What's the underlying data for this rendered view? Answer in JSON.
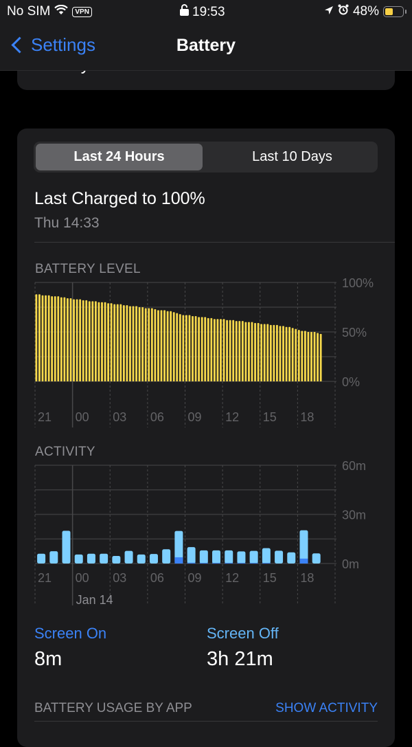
{
  "status_bar": {
    "carrier": "No SIM",
    "vpn": "VPN",
    "time": "19:53",
    "battery_percent": "48%",
    "battery_level": 0.48,
    "battery_color": "#f7d046"
  },
  "nav": {
    "back_label": "Settings",
    "title": "Battery"
  },
  "health_row": {
    "label": "Battery Health"
  },
  "segmented": {
    "options": [
      "Last 24 Hours",
      "Last 10 Days"
    ],
    "selected": "Last 24 Hours"
  },
  "last_charged": {
    "title": "Last Charged to 100%",
    "time": "Thu 14:33"
  },
  "battery_section_label": "BATTERY LEVEL",
  "activity_section_label": "ACTIVITY",
  "stats": {
    "screen_on": {
      "label": "Screen On",
      "value": "8m",
      "color": "#3b82f6"
    },
    "screen_off": {
      "label": "Screen Off",
      "value": "3h 21m",
      "color": "#64b5f6"
    }
  },
  "usage": {
    "label": "BATTERY USAGE BY APP",
    "action": "SHOW ACTIVITY"
  },
  "chart_data": [
    {
      "type": "bar",
      "title": "BATTERY LEVEL",
      "xlabel": "",
      "ylabel": "",
      "ylim": [
        0,
        100
      ],
      "yticks": [
        "0%",
        "50%",
        "100%"
      ],
      "xticks": [
        "21",
        "00",
        "03",
        "06",
        "09",
        "12",
        "15",
        "18"
      ],
      "interval_minutes": 15,
      "color": "#f7d94c",
      "values": [
        88,
        88,
        87,
        87,
        87,
        86,
        86,
        86,
        85,
        85,
        84,
        84,
        83,
        83,
        83,
        82,
        82,
        81,
        81,
        81,
        80,
        80,
        80,
        79,
        79,
        78,
        78,
        78,
        77,
        77,
        76,
        76,
        76,
        75,
        75,
        74,
        74,
        74,
        73,
        72,
        72,
        72,
        71,
        71,
        70,
        69,
        68,
        67,
        67,
        67,
        66,
        66,
        65,
        65,
        65,
        64,
        64,
        63,
        63,
        63,
        63,
        62,
        62,
        62,
        61,
        61,
        61,
        60,
        60,
        60,
        59,
        59,
        58,
        58,
        58,
        57,
        57,
        57,
        56,
        56,
        55,
        55,
        54,
        53,
        52,
        51,
        51,
        50,
        50,
        50,
        49,
        48
      ]
    },
    {
      "type": "bar",
      "title": "ACTIVITY",
      "xlabel": "",
      "ylabel": "",
      "ylim": [
        0,
        60
      ],
      "yticks": [
        "0m",
        "30m",
        "60m"
      ],
      "xticks": [
        "21",
        "00",
        "03",
        "06",
        "09",
        "12",
        "15",
        "18"
      ],
      "date_label": "Jan 14",
      "series": [
        {
          "name": "Screen On",
          "color": "#3b82f6",
          "values": [
            0,
            0,
            0,
            0,
            0,
            0,
            0,
            0,
            0,
            0,
            0,
            3.8,
            0.5,
            0.4,
            0.4,
            0.4,
            0.4,
            0.4,
            0.4,
            0,
            0,
            3,
            0
          ]
        },
        {
          "name": "Screen Off",
          "color": "#7dcfff",
          "values": [
            6,
            7.5,
            20,
            5.5,
            6,
            6,
            4.6,
            7.7,
            5.5,
            5.8,
            8.7,
            16.1,
            9.5,
            7.6,
            7.6,
            7.6,
            7,
            7.3,
            9,
            7.8,
            6.8,
            17.3,
            6.2
          ]
        }
      ]
    }
  ]
}
